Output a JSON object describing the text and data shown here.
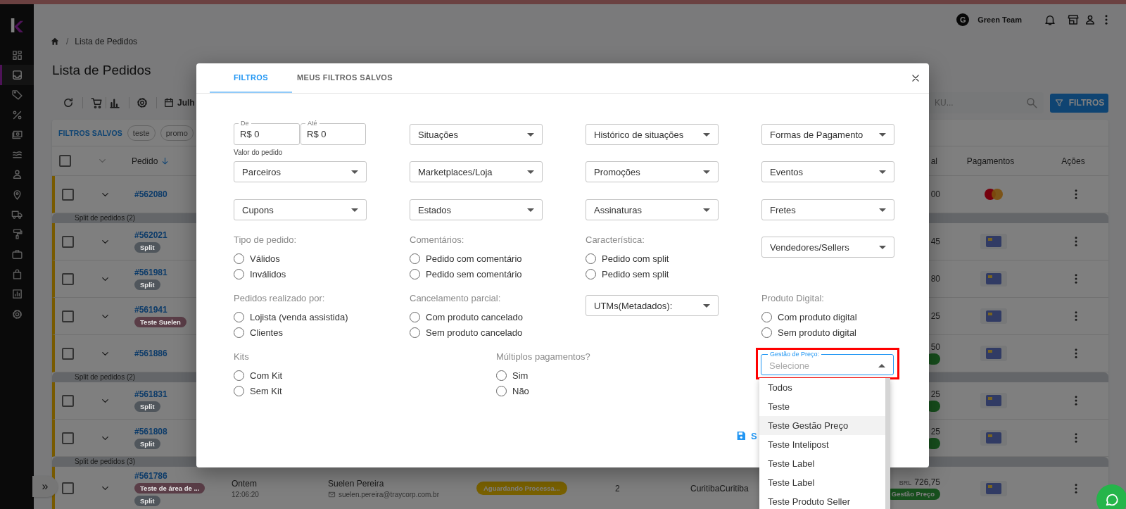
{
  "top_bar": {
    "account_initial": "G",
    "account_name": "Green Team"
  },
  "sidebar": {
    "items": [
      {
        "selected": false
      },
      {
        "selected": true
      },
      {
        "selected": false
      },
      {
        "selected": false
      },
      {
        "selected": false
      },
      {
        "selected": false
      },
      {
        "selected": false
      },
      {
        "selected": false
      },
      {
        "selected": false
      },
      {
        "selected": false
      },
      {
        "selected": false
      },
      {
        "selected": false
      },
      {
        "selected": false
      },
      {
        "selected": false
      }
    ],
    "expand_button": "»"
  },
  "breadcrumb": {
    "separator": "/",
    "current": "Lista de Pedidos"
  },
  "page_title": "Lista de Pedidos",
  "toolbar": {
    "date_range": "Julh",
    "search_placeholder": "KU...",
    "filter_button": "FILTROS"
  },
  "table": {
    "saved_filters_label": "FILTROS SALVOS",
    "saved_filters": [
      "teste",
      "promo"
    ],
    "select_all_checked": false,
    "columns": [
      {
        "label": "Pedido",
        "sorted": true
      },
      {
        "label": "al",
        "sorted": false
      },
      {
        "label": "Pagamentos",
        "sorted": false
      },
      {
        "label": "Ações",
        "sorted": false
      }
    ],
    "rows": [
      {
        "kind": "order",
        "checked": false,
        "number": "#562080",
        "total": "00",
        "status_badge": false,
        "payment": {
          "kind": "mastercard"
        }
      },
      {
        "kind": "split",
        "label": "Split de pedidos (2)"
      },
      {
        "kind": "order",
        "checked": false,
        "number": "#562021",
        "tags": [
          {
            "text": "Split",
            "color": "#50565c"
          }
        ],
        "total": "45",
        "status_badge": false,
        "payment": {
          "kind": "card"
        }
      },
      {
        "kind": "order",
        "checked": false,
        "number": "#561981",
        "tags": [
          {
            "text": "Split",
            "color": "#50565c"
          }
        ],
        "total": "80",
        "status_badge": false,
        "payment": {
          "kind": "card"
        }
      },
      {
        "kind": "order",
        "checked": false,
        "number": "#561941",
        "tags": [
          {
            "text": "Teste Suelen",
            "color": "#5a3d47"
          }
        ],
        "total": "25",
        "status_badge": false,
        "payment": {
          "kind": "card"
        }
      },
      {
        "kind": "order",
        "checked": false,
        "number": "#561886",
        "total": "50",
        "status_badge": true,
        "payment": {
          "kind": "card"
        }
      },
      {
        "kind": "split",
        "label": "Split de pedidos (2)"
      },
      {
        "kind": "order",
        "checked": false,
        "number": "#561831",
        "tags": [
          {
            "text": "Split",
            "color": "#50565c"
          }
        ],
        "total": "25",
        "status_badge": true,
        "payment": {
          "kind": "card"
        }
      },
      {
        "kind": "order",
        "checked": false,
        "number": "#561808",
        "tags": [
          {
            "text": "Split",
            "color": "#50565c"
          }
        ],
        "total": "25",
        "status_badge": true,
        "payment": {
          "kind": "card"
        }
      },
      {
        "kind": "split",
        "label": "Split de pedidos (3)"
      },
      {
        "kind": "order",
        "checked": false,
        "number": "#561786",
        "tags": [
          {
            "text": "Teste de área de ...",
            "color": "#5a3d47"
          },
          {
            "text": "Split",
            "color": "#50565c"
          }
        ],
        "date": "Ontem",
        "time": "12:06:20",
        "customer": "Suelen Pereira",
        "email": "suelen.pereira@traycorp.com.br",
        "status": "Aguardando Processa...",
        "quantity": "2",
        "city": "CuritibaCuritiba",
        "currency": "BRL",
        "total": "726,75",
        "status_badge": true,
        "badge_text": "Gestão Preço",
        "payment": {
          "kind": "card"
        }
      }
    ]
  },
  "filter_dialog": {
    "tabs": [
      {
        "label": "FILTROS",
        "selected": true
      },
      {
        "label": "MEUS FILTROS SALVOS",
        "selected": false
      }
    ],
    "fields": [
      {
        "kind": "range",
        "from": {
          "label": "De",
          "value": "R$ 0"
        },
        "to": {
          "label": "Até",
          "value": "R$ 0"
        },
        "helper": "Valor do pedido"
      },
      {
        "kind": "select",
        "label": "Situações",
        "open": false
      },
      {
        "kind": "select",
        "label": "Histórico de situações",
        "open": false
      },
      {
        "kind": "select",
        "label": "Formas de Pagamento",
        "open": false
      },
      {
        "kind": "select",
        "label": "Parceiros",
        "open": false
      },
      {
        "kind": "select",
        "label": "Marketplaces/Loja",
        "open": false
      },
      {
        "kind": "select",
        "label": "Promoções",
        "open": false
      },
      {
        "kind": "select",
        "label": "Eventos",
        "open": false
      },
      {
        "kind": "select",
        "label": "Cupons",
        "open": false
      },
      {
        "kind": "select",
        "label": "Estados",
        "open": false
      },
      {
        "kind": "select",
        "label": "Assinaturas",
        "open": false
      },
      {
        "kind": "select",
        "label": "Fretes",
        "open": false
      },
      {
        "kind": "radio_group",
        "label": "Tipo de pedido:",
        "options": [
          {
            "label": "Válidos",
            "checked": false
          },
          {
            "label": "Inválidos",
            "checked": false
          }
        ]
      },
      {
        "kind": "radio_group",
        "label": "Comentários:",
        "options": [
          {
            "label": "Pedido com comentário",
            "checked": false
          },
          {
            "label": "Pedido sem comentário",
            "checked": false
          }
        ]
      },
      {
        "kind": "radio_group",
        "label": "Característica:",
        "options": [
          {
            "label": "Pedido com split",
            "checked": false
          },
          {
            "label": "Pedido sem split",
            "checked": false
          }
        ]
      },
      {
        "kind": "select",
        "label": "Vendedores/Sellers",
        "open": false
      },
      {
        "kind": "radio_group",
        "label": "Pedidos realizado por:",
        "options": [
          {
            "label": "Lojista (venda assistida)",
            "checked": false
          },
          {
            "label": "Clientes",
            "checked": false
          }
        ]
      },
      {
        "kind": "radio_group",
        "label": "Cancelamento parcial:",
        "options": [
          {
            "label": "Com produto cancelado",
            "checked": false
          },
          {
            "label": "Sem produto cancelado",
            "checked": false
          }
        ]
      },
      {
        "kind": "select",
        "label": "UTMs(Metadados):",
        "open": false
      },
      {
        "kind": "radio_group",
        "label": "Produto Digital:",
        "options": [
          {
            "label": "Com produto digital",
            "checked": false
          },
          {
            "label": "Sem produto digital",
            "checked": false
          }
        ]
      }
    ],
    "bottom_fields": [
      {
        "kind": "radio_group",
        "label": "Kits",
        "options": [
          {
            "label": "Com Kit",
            "checked": false
          },
          {
            "label": "Sem Kit",
            "checked": false
          }
        ]
      },
      {
        "kind": "radio_group",
        "label": "Múltiplos pagamentos?",
        "options": [
          {
            "label": "Sim",
            "checked": false
          },
          {
            "label": "Não",
            "checked": false
          }
        ]
      },
      {
        "kind": "select",
        "label": "Gestão de Preço:",
        "placeholder": "Selecione",
        "open": true,
        "marked": true,
        "options": [
          {
            "label": "Todos",
            "hovered": false
          },
          {
            "label": "Teste",
            "hovered": false
          },
          {
            "label": "Teste Gestão Preço",
            "hovered": true
          },
          {
            "label": "Teste Intelipost",
            "hovered": false
          },
          {
            "label": "Teste Label",
            "hovered": false
          },
          {
            "label": "Teste Label",
            "hovered": false
          },
          {
            "label": "Teste Produto Seller",
            "hovered": false
          }
        ]
      }
    ],
    "save_button": "S"
  }
}
